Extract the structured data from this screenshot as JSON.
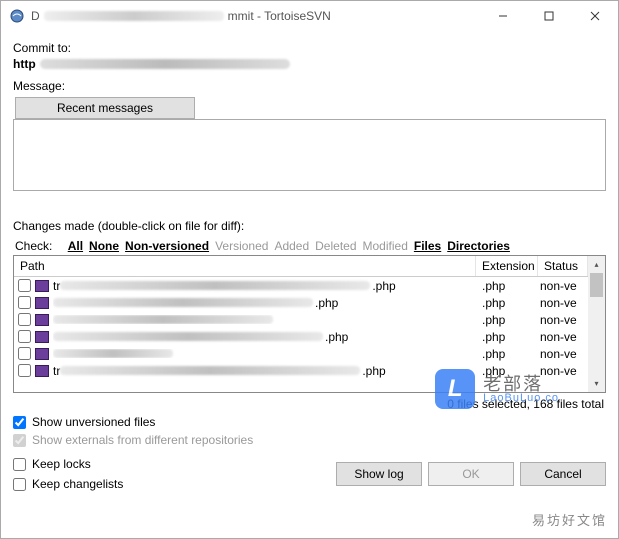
{
  "window": {
    "title_prefix": "D",
    "title_suffix_visible": "mmit - TortoiseSVN"
  },
  "commit_to_label": "Commit to:",
  "url_prefix": "http",
  "message_label": "Message:",
  "recent_messages_btn": "Recent messages",
  "message_value": "",
  "changes_label": "Changes made (double-click on file for diff):",
  "check_label": "Check:",
  "filters": {
    "all": "All",
    "none": "None",
    "non_versioned": "Non-versioned",
    "versioned": "Versioned",
    "added": "Added",
    "deleted": "Deleted",
    "modified": "Modified",
    "files": "Files",
    "directories": "Directories"
  },
  "columns": {
    "path": "Path",
    "extension": "Extension",
    "status": "Status"
  },
  "rows": [
    {
      "prefix": "tr",
      "redact_w": 310,
      "suffix": ".php",
      "ext": ".php",
      "status": "non-ve"
    },
    {
      "prefix": "",
      "redact_w": 260,
      "suffix": ".php",
      "ext": ".php",
      "status": "non-ve"
    },
    {
      "prefix": "",
      "redact_w": 220,
      "suffix": "",
      "ext": ".php",
      "status": "non-ve"
    },
    {
      "prefix": "",
      "redact_w": 270,
      "suffix": ".php",
      "ext": ".php",
      "status": "non-ve"
    },
    {
      "prefix": "",
      "redact_w": 120,
      "suffix": "",
      "ext": ".php",
      "status": "non-ve"
    },
    {
      "prefix": "tr",
      "redact_w": 300,
      "suffix": ".php",
      "ext": ".php",
      "status": "non-ve"
    }
  ],
  "selection_status": "0 files selected, 168 files total",
  "checkboxes": {
    "show_unversioned": "Show unversioned files",
    "show_externals": "Show externals from different repositories",
    "keep_locks": "Keep locks",
    "keep_changelists": "Keep changelists"
  },
  "buttons": {
    "show_log": "Show log",
    "ok": "OK",
    "cancel": "Cancel"
  },
  "watermark": {
    "cn": "老部落",
    "en": "LaoBuLuo.co"
  },
  "corner_text": "易坊好文馆"
}
